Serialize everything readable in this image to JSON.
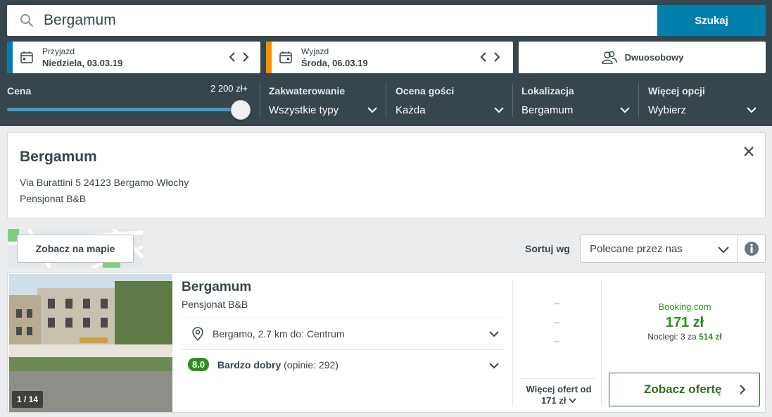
{
  "search": {
    "value": "Bergamum",
    "button_label": "Szukaj"
  },
  "checkin": {
    "label": "Przyjazd",
    "date": "Niedziela, 03.03.19",
    "accent": "#007fad"
  },
  "checkout": {
    "label": "Wyjazd",
    "date": "Środa, 06.03.19",
    "accent": "#f48f00"
  },
  "room": {
    "label": "Dwuosobowy"
  },
  "filters": {
    "price": {
      "title": "Cena",
      "value": "2 200 zł+",
      "level": 1.0
    },
    "accommodation": {
      "title": "Zakwaterowanie",
      "value": "Wszystkie typy"
    },
    "rating": {
      "title": "Ocena gości",
      "value": "Każda"
    },
    "location": {
      "title": "Lokalizacja",
      "value": "Bergamum"
    },
    "more": {
      "title": "Więcej opcji",
      "value": "Wybierz"
    }
  },
  "info_card": {
    "title": "Bergamum",
    "address": "Via Burattini 5 24123 Bergamo Włochy",
    "type": "Pensjonat B&B"
  },
  "map": {
    "button_label": "Zobacz na mapie"
  },
  "sort": {
    "label": "Sortuj wg",
    "value": "Polecane przez nas"
  },
  "result": {
    "photo_counter": "1 / 14",
    "name": "Bergamum",
    "type": "Pensjonat B&B",
    "location": "Bergamo, 2.7 km do: Centrum",
    "rating_score": "8.0",
    "rating_label": "Bardzo dobry",
    "rating_reviews": "(opinie: 292)",
    "dashes": [
      "–",
      "–",
      "–"
    ],
    "more_offers_label": "Więcej ofert od",
    "more_offers_price": "171 zł",
    "provider": "Booking.com",
    "price": "171 zł",
    "nights_prefix": "Noclegi: 3 za",
    "nights_total": "514 zł",
    "offer_button_label": "Zobacz ofertę"
  },
  "colors": {
    "header_bg": "#37454d",
    "accent_blue": "#007fad",
    "deal_green": "#2f8f1e"
  }
}
